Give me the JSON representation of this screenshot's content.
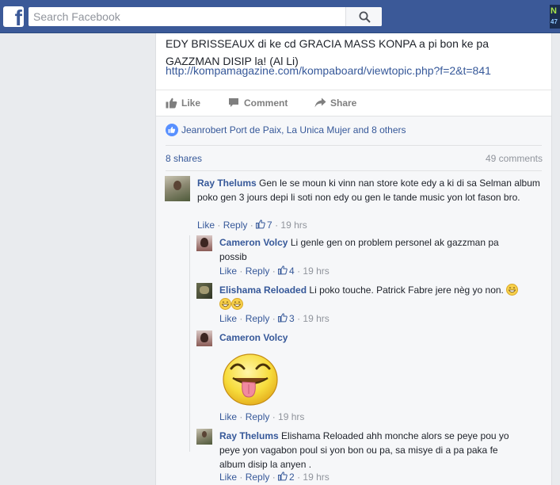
{
  "topbar": {
    "logo": "f",
    "search_placeholder": "Search Facebook",
    "search_value": "",
    "corner_badge_line1": "N",
    "corner_badge_line2": "47"
  },
  "post": {
    "text": "EDY BRISSEAUX di ke cd GRACIA MASS KONPA a pi bon ke pa GAZZMAN DISIP la! (Al Li)",
    "link": "http://kompamagazine.com/kompaboard/viewtopic.php?f=2&t=841",
    "actions": {
      "like": "Like",
      "comment": "Comment",
      "share": "Share"
    }
  },
  "feedback": {
    "reactions_text": "Jeanrobert Port de Paix, La Unica Mujer and 8 others",
    "shares": "8 shares",
    "comments_count": "49 comments"
  },
  "comments": [
    {
      "name": "Ray Thelums",
      "text": "Gen le se moun ki vinn nan store kote edy a ki di sa Selman album poko gen 3 jours depi li soti non edy ou gen le tande music yon lot fason bro.",
      "like": "Like",
      "reply": "Reply",
      "likes": "7",
      "time": "19 hrs"
    },
    {
      "name": "Cameron Volcy",
      "text": "Li genle gen on problem personel ak gazzman pa possib",
      "like": "Like",
      "reply": "Reply",
      "likes": "4",
      "time": "19 hrs"
    },
    {
      "name": "Elishama Reloaded",
      "text": "Li poko touche. Patrick Fabre jere nèg yo non.",
      "like": "Like",
      "reply": "Reply",
      "likes": "3",
      "time": "19 hrs"
    },
    {
      "name": "Cameron Volcy",
      "text": "",
      "like": "Like",
      "reply": "Reply",
      "likes": "",
      "time": "19 hrs"
    },
    {
      "name": "Ray Thelums",
      "text": "Elishama Reloaded ahh monche alors se peye pou yo peye yon vagabon poul si yon bon ou pa, sa misye di a pa paka fe album disip la anyen .",
      "like": "Like",
      "reply": "Reply",
      "likes": "2",
      "time": "19 hrs"
    }
  ],
  "colors": {
    "facebook_blue": "#3b5998",
    "link_blue": "#365899",
    "meta_gray": "#90949c",
    "feed_bg": "#e9ebee"
  }
}
